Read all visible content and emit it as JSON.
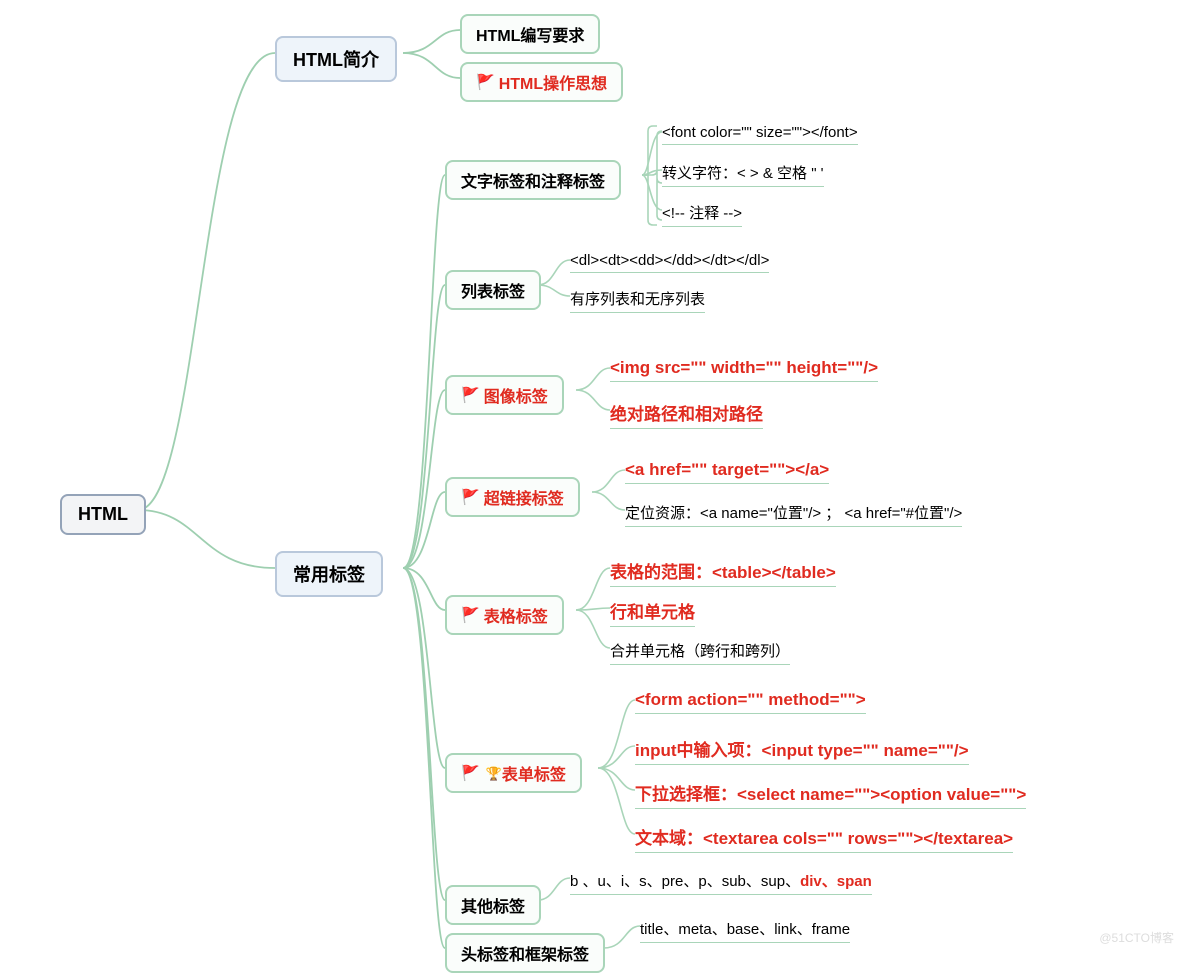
{
  "root": "HTML",
  "n1": {
    "label": "HTML简介"
  },
  "n1c": {
    "a": "HTML编写要求",
    "b": "HTML操作思想"
  },
  "n2": {
    "label": "常用标签"
  },
  "n2a": {
    "label": "文字标签和注释标签",
    "c": {
      "a": "<font color=\"\" size=\"\"></font>",
      "b": "转义字符：< > & 空格 \" '",
      "c": "<!-- 注释 -->"
    }
  },
  "n2b": {
    "label": "列表标签",
    "c": {
      "a": "<dl><dt><dd></dd></dt></dl>",
      "b": "有序列表和无序列表"
    }
  },
  "n2c": {
    "label": "图像标签",
    "c": {
      "a": "<img src=\"\" width=\"\" height=\"\"/>",
      "b": "绝对路径和相对路径"
    }
  },
  "n2d": {
    "label": "超链接标签",
    "c": {
      "a": "<a href=\"\" target=\"\"></a>",
      "b": "定位资源：<a name=\"位置\"/> ； <a href=\"#位置\"/>"
    }
  },
  "n2e": {
    "label": "表格标签",
    "c": {
      "a": "表格的范围：<table></table>",
      "b": "行和单元格",
      "c": "合并单元格（跨行和跨列）"
    }
  },
  "n2f": {
    "label": "表单标签",
    "c": {
      "a": "<form action=\"\" method=\"\">",
      "b": "input中输入项：<input type=\"\" name=\"\"/>",
      "c": "下拉选择框：<select name=\"\"><option value=\"\">",
      "d": "文本域：<textarea cols=\"\" rows=\"\"></textarea>"
    }
  },
  "n2g": {
    "label": "其他标签",
    "c": {
      "black": "b 、u、i、s、pre、p、sub、sup、",
      "red": "div、span"
    }
  },
  "n2h": {
    "label": "头标签和框架标签",
    "c": {
      "a": "title、meta、base、link、frame"
    }
  },
  "watermark": "@51CTO博客"
}
